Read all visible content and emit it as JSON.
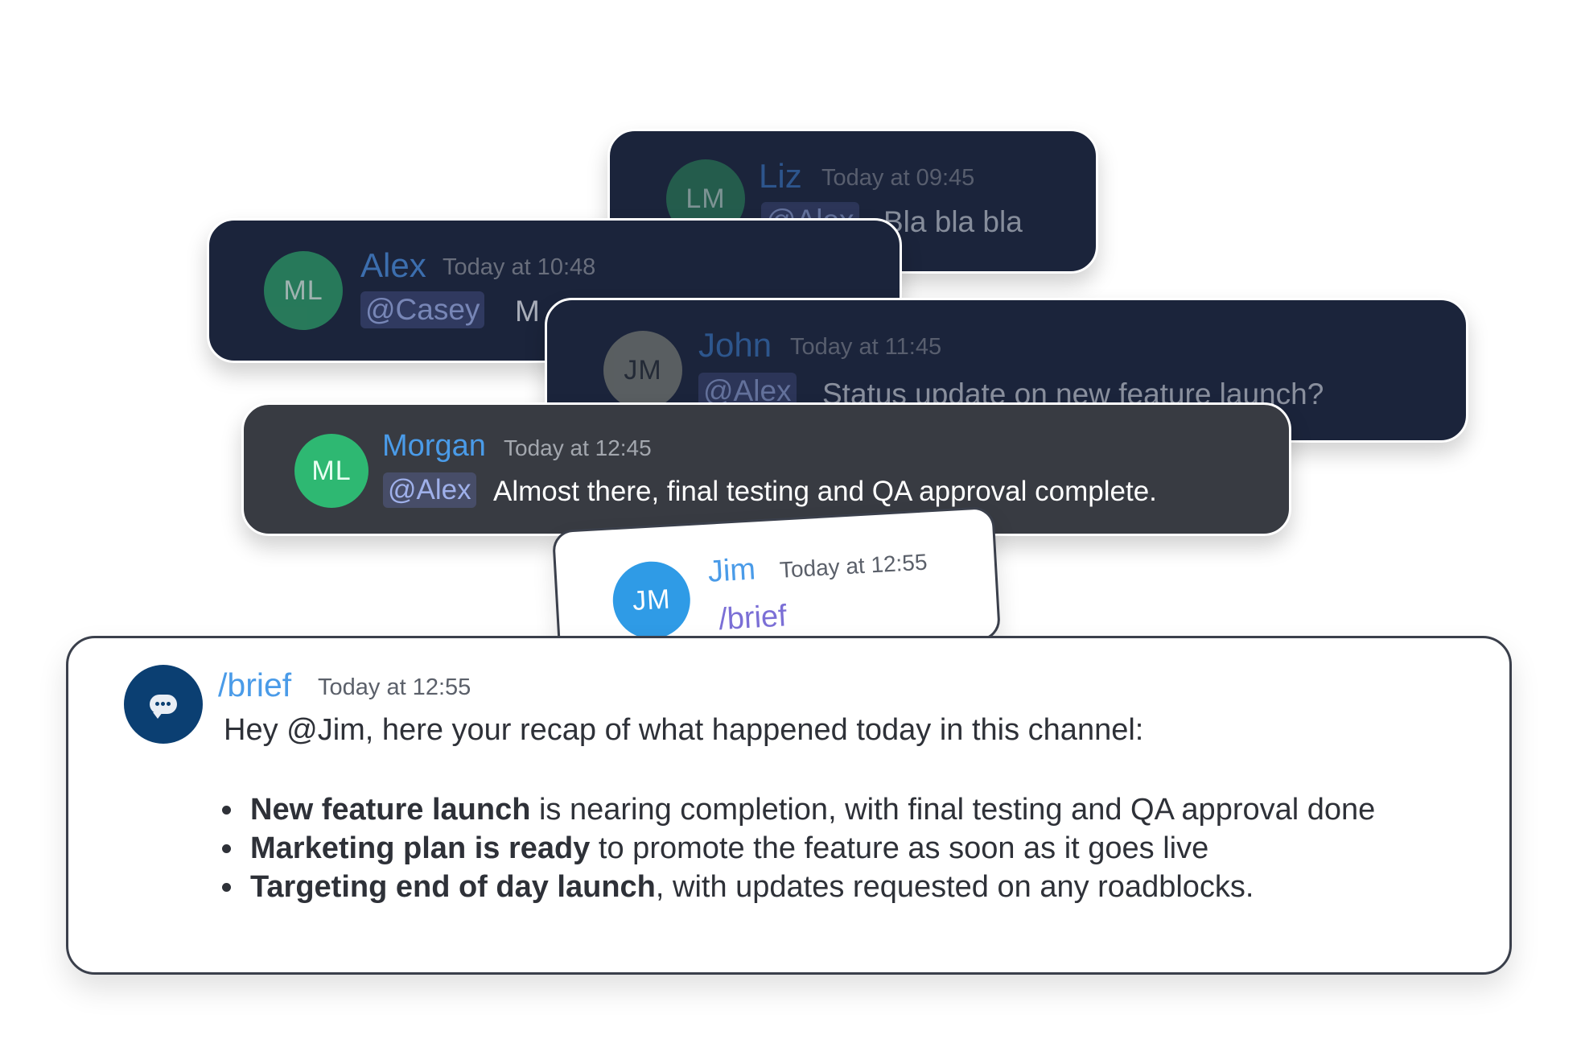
{
  "messages": {
    "liz": {
      "initials": "LM",
      "name": "Liz",
      "time": "Today at 09:45",
      "mention": "@Alex",
      "text": "Bla bla bla"
    },
    "alex": {
      "initials": "ML",
      "name": "Alex",
      "time": "Today at 10:48",
      "mention": "@Casey",
      "text": "M"
    },
    "john": {
      "initials": "JM",
      "name": "John",
      "time": "Today at 11:45",
      "mention": "@Alex",
      "text": "Status update on new feature launch?"
    },
    "morgan": {
      "initials": "ML",
      "name": "Morgan",
      "time": "Today at 12:45",
      "mention": "@Alex",
      "text": "Almost there, final testing and QA approval complete."
    },
    "jim": {
      "initials": "JM",
      "name": "Jim",
      "time": "Today at 12:55",
      "text": "/brief"
    }
  },
  "brief": {
    "bot_icon": "speech-bubble-icon",
    "name": "/brief",
    "time": "Today at 12:55",
    "intro": "Hey @Jim, here your recap of what happened today in this channel:",
    "items": [
      {
        "bold": "New feature launch",
        "rest": " is nearing completion, with final testing and QA approval done"
      },
      {
        "bold": "Marketing plan is ready",
        "rest": " to promote the feature as soon as it goes live"
      },
      {
        "bold": "Targeting end of day launch",
        "rest": ", with updates requested on any roadblocks."
      }
    ]
  },
  "colors": {
    "dark_card": "#1b243b",
    "gray_card": "#383b42",
    "name_blue": "#4a9be8",
    "avatar_green": "#2eb872",
    "avatar_blue": "#2f9be6",
    "bot_navy": "#0b3f72"
  }
}
